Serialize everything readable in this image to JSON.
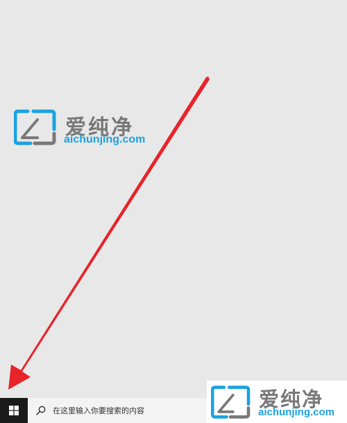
{
  "watermark": {
    "brand_cn": "爱纯净",
    "brand_url": "aichunjing.com",
    "colors": {
      "blue": "#1aa3e0",
      "gray": "#787878"
    }
  },
  "taskbar": {
    "start_icon": "windows-logo-icon",
    "search": {
      "icon": "search-icon",
      "placeholder": "在这里输入你要搜索的内容"
    }
  },
  "annotation": {
    "arrow_color": "#e8232a",
    "points_to": "start-button"
  }
}
